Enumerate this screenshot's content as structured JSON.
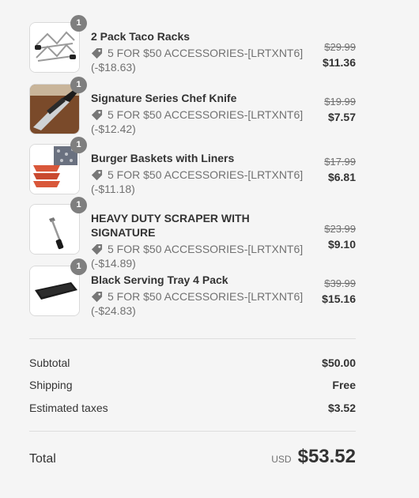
{
  "items": [
    {
      "name": "2 Pack Taco Racks",
      "qty": "1",
      "discount": "5 FOR $50 ACCESSORIES-[LRTXNT6]",
      "saving": "(-$18.63)",
      "old_price": "$29.99",
      "price": "$11.36",
      "thumb": "taco-rack-icon"
    },
    {
      "name": "Signature Series Chef Knife",
      "qty": "1",
      "discount": "5 FOR $50 ACCESSORIES-[LRTXNT6]",
      "saving": "(-$12.42)",
      "old_price": "$19.99",
      "price": "$7.57",
      "thumb": "chef-knife-icon"
    },
    {
      "name": "Burger Baskets with Liners",
      "qty": "1",
      "discount": "5 FOR $50 ACCESSORIES-[LRTXNT6]",
      "saving": "(-$11.18)",
      "old_price": "$17.99",
      "price": "$6.81",
      "thumb": "burger-basket-icon"
    },
    {
      "name": "HEAVY DUTY SCRAPER WITH SIGNATURE",
      "qty": "1",
      "discount": "5 FOR $50 ACCESSORIES-[LRTXNT6]",
      "saving": "(-$14.89)",
      "old_price": "$23.99",
      "price": "$9.10",
      "thumb": "scraper-icon"
    },
    {
      "name": "Black Serving Tray 4 Pack",
      "qty": "1",
      "discount": "5 FOR $50 ACCESSORIES-[LRTXNT6]",
      "saving": "(-$24.83)",
      "old_price": "$39.99",
      "price": "$15.16",
      "thumb": "serving-tray-icon"
    }
  ],
  "summary": {
    "subtotal_label": "Subtotal",
    "subtotal_value": "$50.00",
    "shipping_label": "Shipping",
    "shipping_value": "Free",
    "taxes_label": "Estimated taxes",
    "taxes_value": "$3.52",
    "total_label": "Total",
    "currency": "USD",
    "total_value": "$53.52"
  },
  "colors": {
    "background": "#f5f5f5",
    "badge": "#7f7f7f",
    "text": "#333333",
    "muted": "#717171"
  }
}
